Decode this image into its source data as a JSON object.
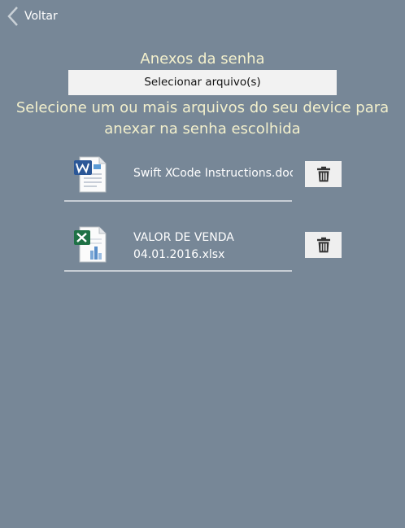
{
  "nav": {
    "back_label": "Voltar"
  },
  "page": {
    "title": "Anexos da senha",
    "select_button_label": "Selecionar arquivo(s)",
    "hint": "Selecione um ou mais arquivos do seu device para anexar na senha escolhida"
  },
  "attachments": [
    {
      "name": "Swift XCode Instructions.docx",
      "type": "word-document-icon"
    },
    {
      "name": "VALOR DE VENDA 04.01.2016.xlsx",
      "type": "excel-spreadsheet-icon"
    }
  ],
  "colors": {
    "background": "#778797",
    "heading_text": "#f3f0cc",
    "button_background": "#f2f2f2"
  }
}
